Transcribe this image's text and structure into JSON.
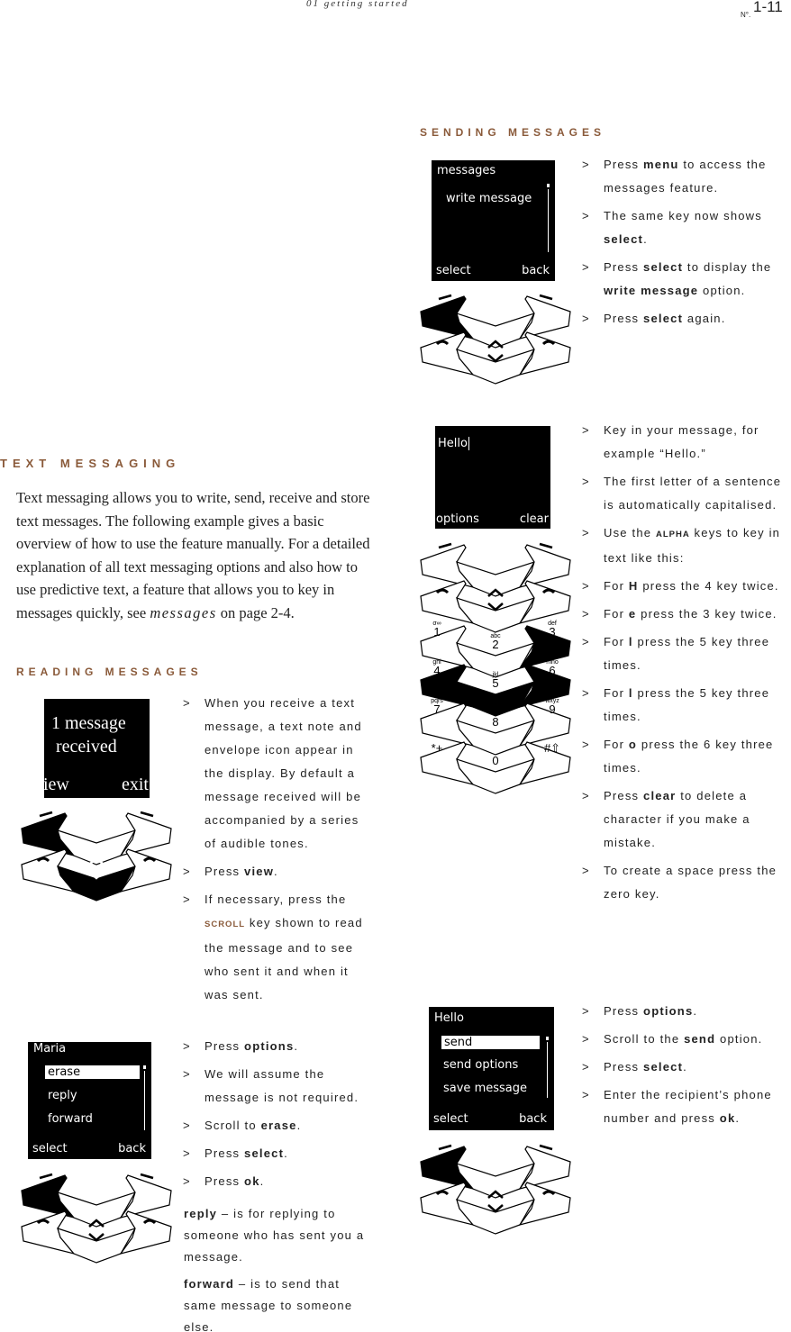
{
  "header": {
    "section": "01 getting started",
    "page": "1-11",
    "page_label": "N°."
  },
  "sending": {
    "title": "SENDING MESSAGES",
    "screen": {
      "title": "messages",
      "item": "write message",
      "left": "select",
      "right": "back"
    },
    "steps": [
      [
        {
          "t": "Press "
        },
        {
          "t": "menu",
          "b": true
        },
        {
          "t": " to access the messages feature."
        }
      ],
      [
        {
          "t": "The same key now shows "
        },
        {
          "t": "select",
          "b": true
        },
        {
          "t": "."
        }
      ],
      [
        {
          "t": "Press "
        },
        {
          "t": "select",
          "b": true
        },
        {
          "t": " to display the "
        },
        {
          "t": "write  message",
          "b": true
        },
        {
          "t": " option."
        }
      ],
      [
        {
          "t": "Press "
        },
        {
          "t": "select",
          "b": true
        },
        {
          "t": " again."
        }
      ]
    ]
  },
  "compose": {
    "screen": {
      "text": "Hello",
      "left": "options",
      "right": "clear"
    },
    "steps": [
      [
        {
          "t": "Key in your message, for example “Hello.”"
        }
      ],
      [
        {
          "t": "The first letter of a sentence is automatically capitalised."
        }
      ],
      [
        {
          "t": "Use the "
        },
        {
          "t": "ALPHA",
          "b": true,
          "sc": true
        },
        {
          "t": " keys to key in text like this:"
        }
      ],
      [
        {
          "t": "For  "
        },
        {
          "t": "H",
          "b": true
        },
        {
          "t": " press the 4 key twice."
        }
      ],
      [
        {
          "t": "For "
        },
        {
          "t": "e",
          "b": true
        },
        {
          "t": "  press the 3 key twice."
        }
      ],
      [
        {
          "t": "For "
        },
        {
          "t": "l",
          "b": true
        },
        {
          "t": " press the 5 key three times."
        }
      ],
      [
        {
          "t": "For "
        },
        {
          "t": "l",
          "b": true
        },
        {
          "t": "  press the 5 key three times."
        }
      ],
      [
        {
          "t": "For  "
        },
        {
          "t": "o",
          "b": true
        },
        {
          "t": " press the 6 key three times."
        }
      ],
      [
        {
          "t": "Press "
        },
        {
          "t": "clear",
          "b": true
        },
        {
          "t": " to delete a character if you make a mistake."
        }
      ],
      [
        {
          "t": "To create a space press the zero key."
        }
      ]
    ],
    "keys": [
      {
        "num": "1",
        "letters": "σ∞"
      },
      {
        "num": "2",
        "letters": "abc"
      },
      {
        "num": "3",
        "letters": "def"
      },
      {
        "num": "4",
        "letters": "ghi"
      },
      {
        "num": "5",
        "letters": "jkl"
      },
      {
        "num": "6",
        "letters": "mno"
      },
      {
        "num": "7",
        "letters": "pqrs"
      },
      {
        "num": "8",
        "letters": "tuv"
      },
      {
        "num": "9",
        "letters": "wxyz"
      },
      {
        "num": "*+",
        "letters": ""
      },
      {
        "num": "0",
        "letters": ""
      },
      {
        "num": "#⇧",
        "letters": ""
      }
    ]
  },
  "send": {
    "screen": {
      "title": "Hello",
      "items": [
        "send",
        "send options",
        "save message"
      ],
      "left": "select",
      "right": "back"
    },
    "steps": [
      [
        {
          "t": "Press "
        },
        {
          "t": "options",
          "b": true
        },
        {
          "t": "."
        }
      ],
      [
        {
          "t": "Scroll to the "
        },
        {
          "t": "send",
          "b": true
        },
        {
          "t": " option."
        }
      ],
      [
        {
          "t": "Press "
        },
        {
          "t": "select",
          "b": true
        },
        {
          "t": "."
        }
      ],
      [
        {
          "t": "Enter the recipient’s phone number and press "
        },
        {
          "t": "ok",
          "b": true
        },
        {
          "t": "."
        }
      ]
    ]
  },
  "texting": {
    "title": "TEXT MESSAGING",
    "intro_a": "Text messaging allows you to write, send, receive and store text messages. The following example gives a basic overview of how to use the feature manually. For a detailed explanation of all text messaging options and also how to use predictive text, a feature that allows you to key in messages quickly, see ",
    "intro_link": "messages",
    "intro_b": " on page 2-4."
  },
  "reading": {
    "title": "READING MESSAGES",
    "screen": {
      "line1": "1 message",
      "line2": "received",
      "left": "view",
      "right": "exit"
    },
    "steps": [
      [
        {
          "t": "When you receive a text message, a text note and envelope icon appear in the display. By default a message received will be accompanied by a series of audible tones."
        }
      ],
      [
        {
          "t": "Press "
        },
        {
          "t": "view",
          "b": true
        },
        {
          "t": "."
        }
      ],
      [
        {
          "t": "If necessary, press the "
        },
        {
          "t": "SCROLL",
          "b": true,
          "sc": true,
          "brown": true
        },
        {
          "t": " key shown to read the message and to see who sent it and when it was sent."
        }
      ]
    ]
  },
  "erase": {
    "screen": {
      "title": "Maria",
      "items": [
        "erase",
        "reply",
        "forward"
      ],
      "left": "select",
      "right": "back"
    },
    "steps": [
      [
        {
          "t": "Press "
        },
        {
          "t": "options",
          "b": true
        },
        {
          "t": "."
        }
      ],
      [
        {
          "t": "We will assume the message is not required."
        }
      ],
      [
        {
          "t": "Scroll to "
        },
        {
          "t": "erase",
          "b": true
        },
        {
          "t": "."
        }
      ],
      [
        {
          "t": "Press "
        },
        {
          "t": "select",
          "b": true
        },
        {
          "t": "."
        }
      ],
      [
        {
          "t": "Press "
        },
        {
          "t": "ok",
          "b": true
        },
        {
          "t": "."
        }
      ]
    ],
    "notes": [
      {
        "term": "reply",
        "text": " – is for replying to someone who has sent you a message."
      },
      {
        "term": "forward",
        "text": " – is to send that same message to someone else."
      }
    ]
  },
  "colors": {
    "heading": "#8a5a3a",
    "screen": "#000000"
  }
}
